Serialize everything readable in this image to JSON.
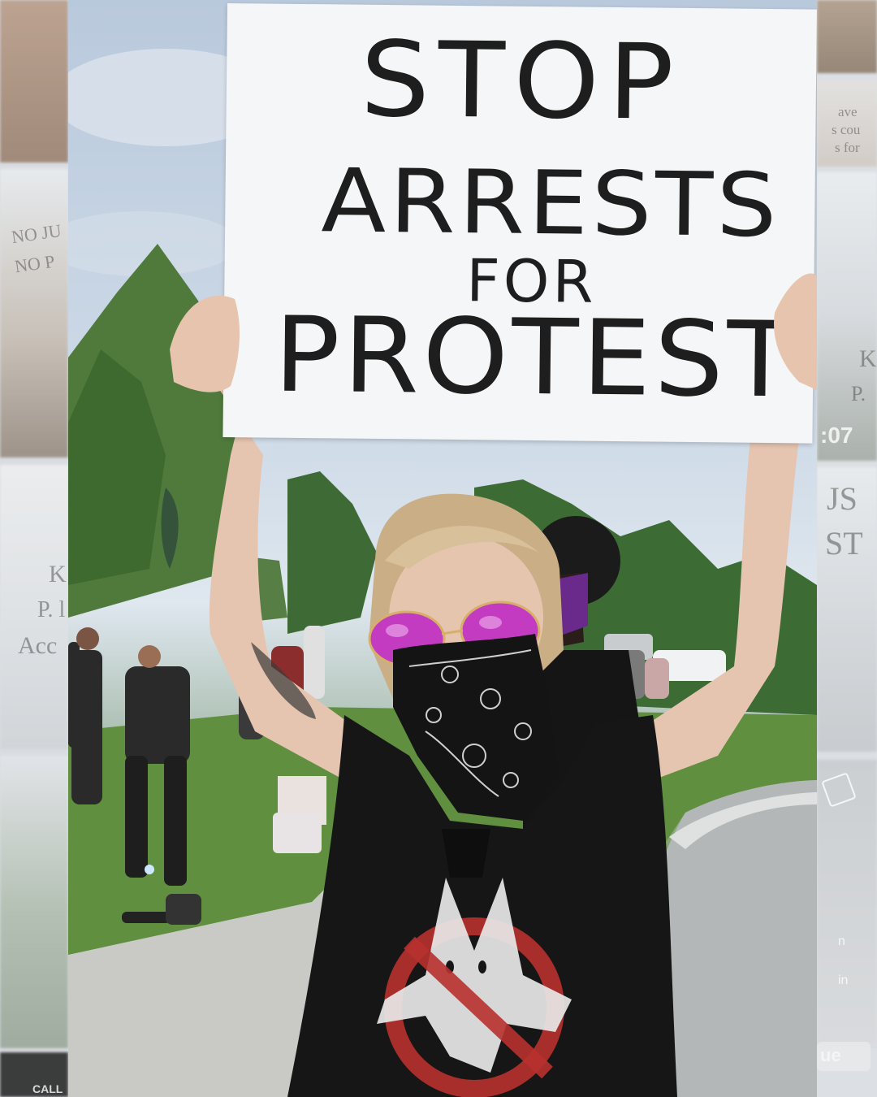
{
  "sign": {
    "line1": "STOP",
    "line2": "ARRESTS",
    "line3": "FOR",
    "line4": "PROTEST"
  },
  "side_fragments": {
    "left_sign_1": "NO JU",
    "left_sign_2": "NO P",
    "left_sign_3": "K",
    "left_sign_4": "P. l",
    "left_sign_5": "Acc",
    "left_bottom": "CALL",
    "right_sign_1": "ave",
    "right_sign_2": "s cou",
    "right_sign_3": "s for",
    "right_sign_4": "K",
    "right_sign_5": "P.",
    "right_time": ":07",
    "right_sign_6": "JS",
    "right_sign_7": "ST",
    "right_small_1": "n",
    "right_small_2": "in",
    "right_button": "ue"
  },
  "colors": {
    "sky": "#c4d3e3",
    "sign": "#f4f6f7",
    "ink": "#1e1e1e",
    "sunglasses": "#c23bc0",
    "shirt": "#141414"
  }
}
